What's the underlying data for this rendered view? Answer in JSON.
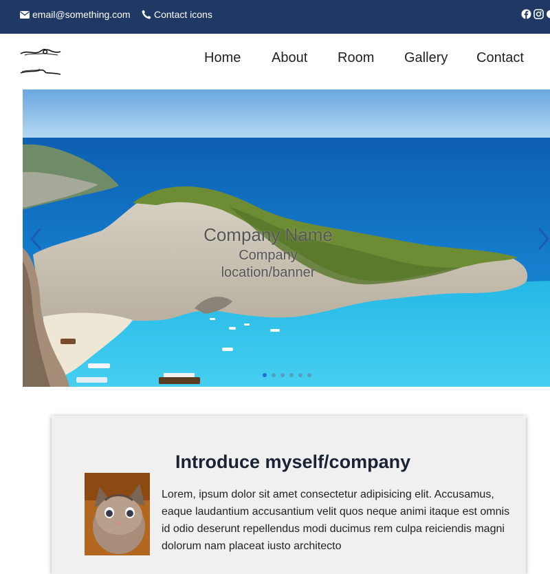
{
  "topbar": {
    "email": "email@something.com",
    "contact": "Contact icons",
    "email_icon": "envelope-icon",
    "contact_icon": "phone-icon",
    "social_icons": [
      "facebook-icon",
      "instagram-icon"
    ],
    "background": "#1f3864"
  },
  "nav": {
    "items": [
      "Home",
      "About",
      "Room",
      "Gallery",
      "Contact"
    ]
  },
  "hero": {
    "company_name": "Company Name",
    "company_location": "Company location/banner",
    "slides_count": 6,
    "active_slide": 1,
    "prev_icon": "chevron-left-icon",
    "next_icon": "chevron-right-icon"
  },
  "intro": {
    "title": "Introduce myself/company",
    "body": "Lorem, ipsum dolor sit amet consectetur adipisicing elit. Accusamus, eaque laudantium accusantium velit quos neque animi itaque est omnis id odio deserunt repellendus modi ducimus rem culpa reiciendis magni dolorum nam placeat iusto architecto"
  }
}
